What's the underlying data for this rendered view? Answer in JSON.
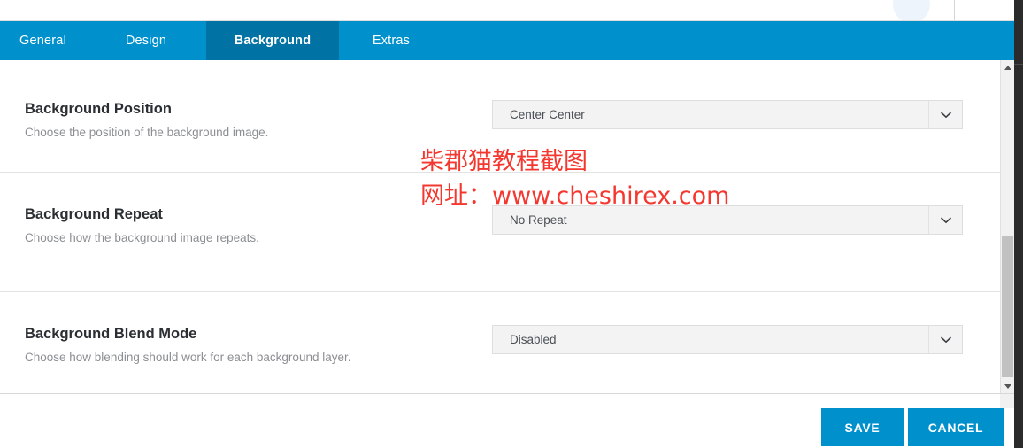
{
  "tabs": [
    {
      "id": "general",
      "label": "General",
      "active": false
    },
    {
      "id": "design",
      "label": "Design",
      "active": false
    },
    {
      "id": "background",
      "label": "Background",
      "active": true
    },
    {
      "id": "extras",
      "label": "Extras",
      "active": false
    }
  ],
  "settings": [
    {
      "title": "Background Position",
      "description": "Choose the position of the background image.",
      "value": "Center Center"
    },
    {
      "title": "Background Repeat",
      "description": "Choose how the background image repeats.",
      "value": "No Repeat"
    },
    {
      "title": "Background Blend Mode",
      "description": "Choose how blending should work for each background layer.",
      "value": "Disabled"
    }
  ],
  "footer": {
    "save_label": "SAVE",
    "cancel_label": "CANCEL"
  },
  "watermark": {
    "line1": "柴郡猫教程截图",
    "line2": "网址：www.cheshirex.com",
    "color": "#f4372f"
  },
  "colors": {
    "tab_bar": "#0091cd",
    "tab_active": "#0072a3",
    "button": "#0091cd",
    "select_bg": "#f3f3f3",
    "title_text": "#2b2f33",
    "desc_text": "#8b8f93"
  },
  "scrollbar": {
    "up_icon": "triangle-up-icon",
    "down_icon": "triangle-down-icon"
  }
}
